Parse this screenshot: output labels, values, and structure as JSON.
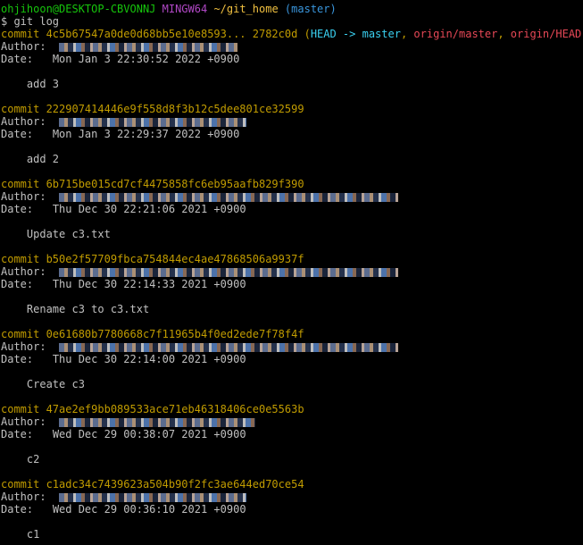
{
  "prompt": {
    "user_host": "ohjihoon@DESKTOP-CBVONNJ",
    "system": "MINGW64",
    "path": "~/git_home",
    "branch": "(master)",
    "command": "$ git log"
  },
  "labels": {
    "author": "Author:",
    "date": "Date:"
  },
  "head_refs": {
    "open": "(",
    "head": "HEAD -> master",
    "sep": ", ",
    "origin_master": "origin/master",
    "origin_head": "origin/HEAD",
    "close": ")"
  },
  "commits": [
    {
      "hash_line": "commit 4c5b67547a0de0d68bb5e10e8593... 2782c0d",
      "date": "Mon Jan 3 22:30:52 2022 +0900",
      "message": "add 3"
    },
    {
      "hash_line": "commit 222907414446e9f558d8f3b12c5dee801ce32599",
      "date": "Mon Jan 3 22:29:37 2022 +0900",
      "message": "add 2"
    },
    {
      "hash_line": "commit 6b715be015cd7cf4475858fc6eb95aafb829f390",
      "date": "Thu Dec 30 22:21:06 2021 +0900",
      "message": "Update c3.txt"
    },
    {
      "hash_line": "commit b50e2f57709fbca754844ec4ae47868506a9937f",
      "date": "Thu Dec 30 22:14:33 2021 +0900",
      "message": "Rename c3 to c3.txt"
    },
    {
      "hash_line": "commit 0e61680b7780668c7f11965b4f0ed2ede7f78f4f",
      "date": "Thu Dec 30 22:14:00 2021 +0900",
      "message": "Create c3"
    },
    {
      "hash_line": "commit 47ae2ef9bb089533ace71eb46318406ce0e5563b",
      "date": "Wed Dec 29 00:38:07 2021 +0900",
      "message": "c2"
    },
    {
      "hash_line": "commit c1adc34c7439623a504b90f2fc3ae644ed70ce54",
      "date": "Wed Dec 29 00:36:10 2021 +0900",
      "message": "c1"
    }
  ],
  "colors": {
    "background": "#000000",
    "text": "#c0c0c0",
    "commit_hash": "#c19c00",
    "head_ref": "#3ad0f0",
    "branch_ref": "#16c60c",
    "remote_ref": "#e74856"
  }
}
